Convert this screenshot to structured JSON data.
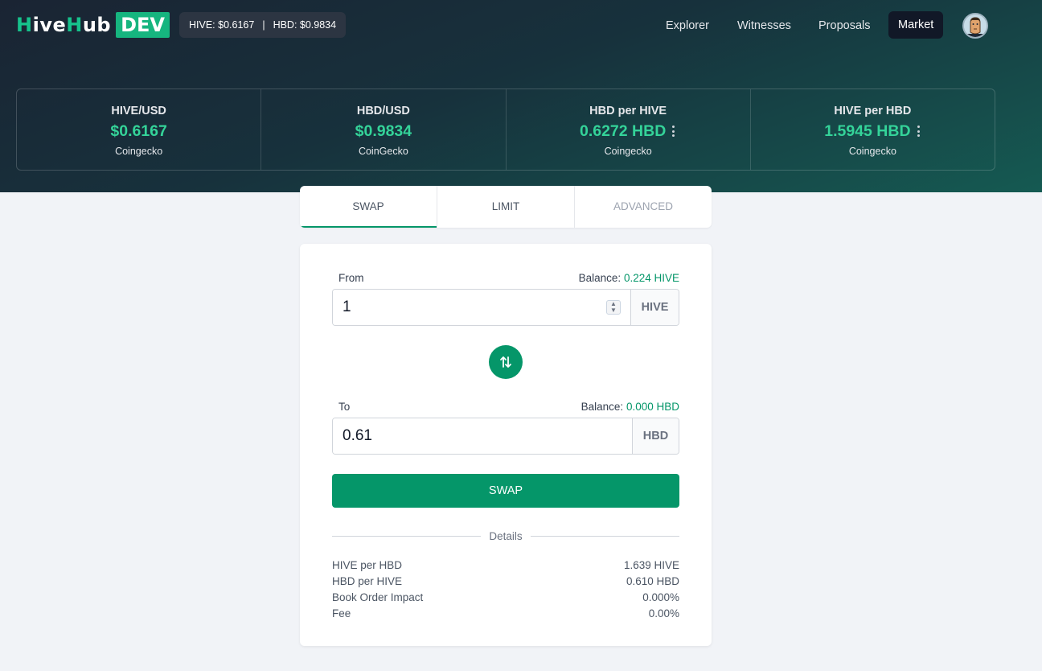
{
  "header": {
    "logo": {
      "part1": "H",
      "part2": "ive",
      "part3": "H",
      "part4": "ub",
      "badge": "DEV"
    },
    "ticker": {
      "hive": "HIVE: $0.6167",
      "separator": "|",
      "hbd": "HBD: $0.9834"
    },
    "nav": [
      {
        "label": "Explorer"
      },
      {
        "label": "Witnesses"
      },
      {
        "label": "Proposals"
      },
      {
        "label": "Market",
        "active": true
      }
    ]
  },
  "stats": [
    {
      "label": "HIVE/USD",
      "value": "$0.6167",
      "source": "Coingecko",
      "menu": false
    },
    {
      "label": "HBD/USD",
      "value": "$0.9834",
      "source": "CoinGecko",
      "menu": false
    },
    {
      "label": "HBD per HIVE",
      "value": "0.6272 HBD",
      "source": "Coingecko",
      "menu": true
    },
    {
      "label": "HIVE per HBD",
      "value": "1.5945 HBD",
      "source": "Coingecko",
      "menu": true
    }
  ],
  "tabs": [
    {
      "label": "SWAP",
      "active": true
    },
    {
      "label": "LIMIT"
    },
    {
      "label": "ADVANCED"
    }
  ],
  "swap": {
    "from": {
      "label": "From",
      "balance_label": "Balance:",
      "balance_value": "0.224 HIVE",
      "amount": "1",
      "currency": "HIVE"
    },
    "to": {
      "label": "To",
      "balance_label": "Balance:",
      "balance_value": "0.000 HBD",
      "amount": "0.61",
      "currency": "HBD"
    },
    "button": "SWAP",
    "details_label": "Details",
    "details": [
      {
        "label": "HIVE per HBD",
        "value": "1.639 HIVE"
      },
      {
        "label": "HBD per HIVE",
        "value": "0.610 HBD"
      },
      {
        "label": "Book Order Impact",
        "value": "0.000%"
      },
      {
        "label": "Fee",
        "value": "0.00%"
      }
    ]
  },
  "colors": {
    "accent": "#059669",
    "accent_light": "#34d399",
    "nav_active_bg": "#111827"
  }
}
